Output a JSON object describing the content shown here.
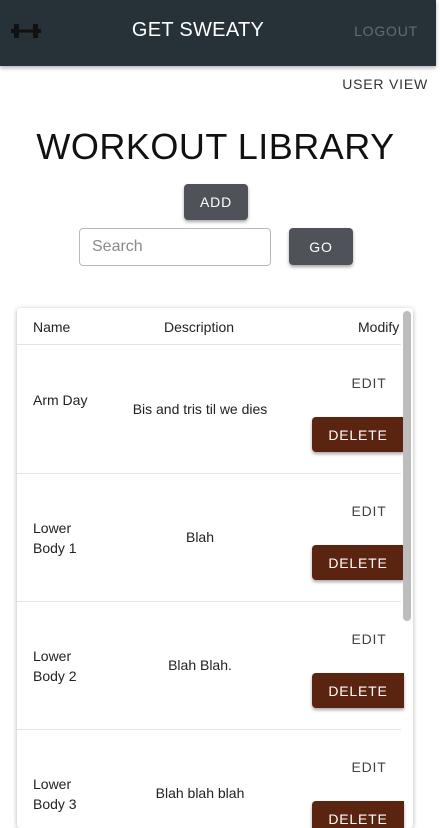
{
  "header": {
    "title": "GET SWEATY",
    "logout_label": "LOGOUT",
    "logo_icon": "dumbbell-icon"
  },
  "user_view_label": "USER VIEW",
  "page_title": "WORKOUT LIBRARY",
  "add_label": "ADD",
  "search": {
    "placeholder": "Search",
    "value": ""
  },
  "go_label": "GO",
  "table": {
    "columns": [
      "Name",
      "Description",
      "Modify"
    ],
    "rows": [
      {
        "name": "Arm Day",
        "description": "Bis and tris til we dies",
        "edit": "EDIT",
        "delete": "DELETE"
      },
      {
        "name": "Lower Body 1",
        "description": "Blah",
        "edit": "EDIT",
        "delete": "DELETE"
      },
      {
        "name": "Lower Body 2",
        "description": "Blah Blah.",
        "edit": "EDIT",
        "delete": "DELETE"
      },
      {
        "name": "Lower Body 3",
        "description": "Blah blah blah",
        "edit": "EDIT",
        "delete": "DELETE"
      }
    ]
  },
  "colors": {
    "appbar": "#263238",
    "button_dark": "#4f5359",
    "delete_button": "#5b2410"
  }
}
